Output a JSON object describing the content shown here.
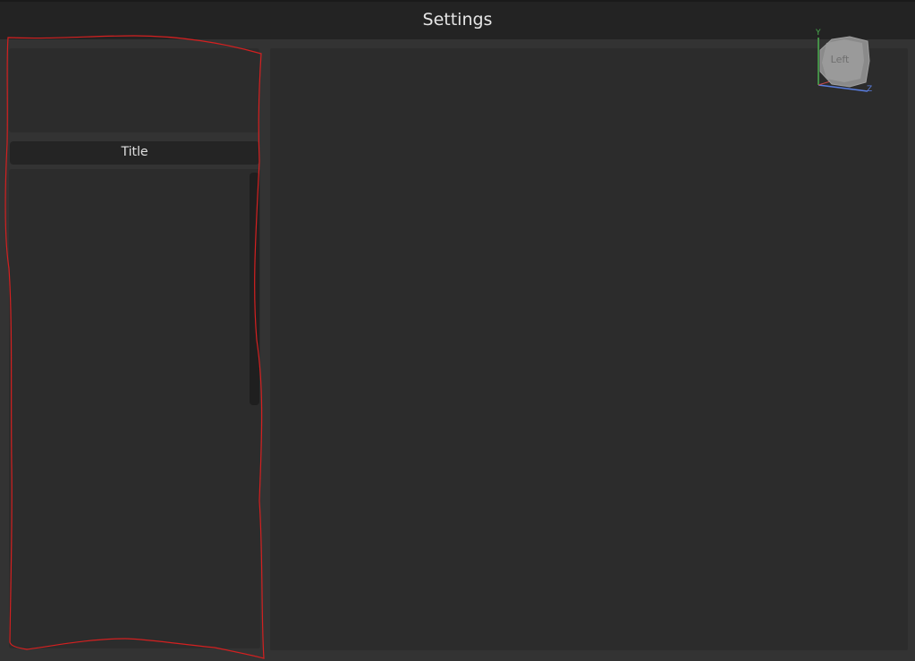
{
  "window": {
    "title": "Settings"
  },
  "left_panel": {
    "header_title": "Title"
  },
  "view_gizmo": {
    "face_label": "Left",
    "axis_y": "Y",
    "axis_z": "Z"
  },
  "colors": {
    "background": "#333333",
    "title_bar": "#232323",
    "panel": "#2c2c2c",
    "header": "#242424",
    "annotation_outline": "#d42020",
    "axis_y": "#4caf50",
    "axis_z": "#5a7ee0"
  }
}
